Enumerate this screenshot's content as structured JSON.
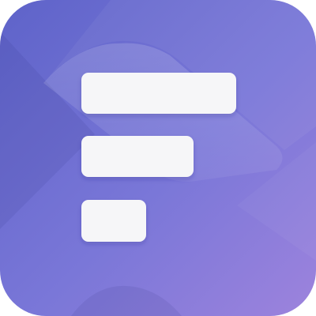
{
  "icon": {
    "name": "forms-app-icon",
    "glyph": "stacked-bars-icon",
    "colors": {
      "gradient_start": "#5E63C9",
      "gradient_mid": "#7A77D8",
      "gradient_end": "#9D83DD",
      "bar_fill": "#F6F6F8",
      "facet_light": "#FFFFFF",
      "facet_dark": "#2B2A7A"
    }
  }
}
